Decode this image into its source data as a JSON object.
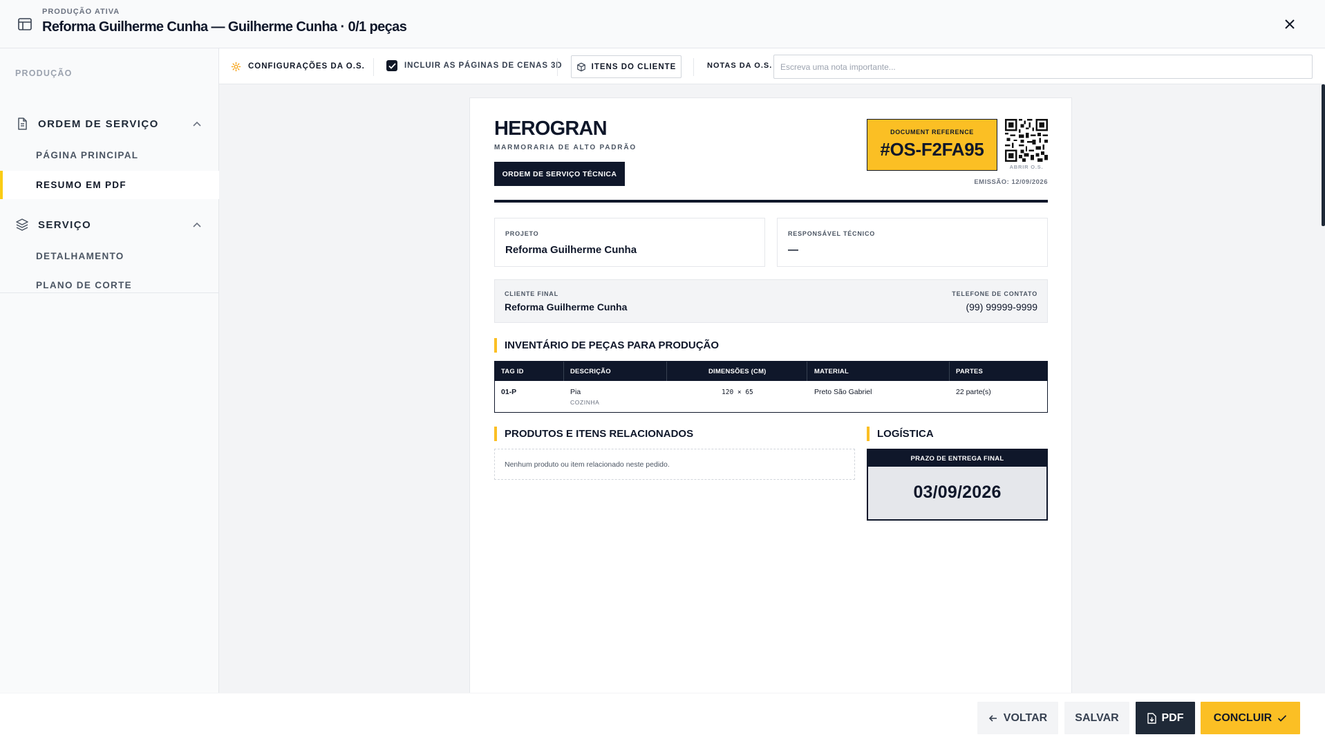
{
  "header": {
    "eyebrow": "PRODUÇÃO ATIVA",
    "title": "Reforma Guilherme Cunha — Guilherme Cunha · 0/1 peças"
  },
  "sidebar": {
    "section_label": "PRODUÇÃO",
    "groups": [
      {
        "label": "ORDEM DE SERVIÇO",
        "icon": "document-icon",
        "expanded": true,
        "items": [
          {
            "label": "PÁGINA PRINCIPAL",
            "active": false
          },
          {
            "label": "RESUMO EM PDF",
            "active": true
          }
        ]
      },
      {
        "label": "SERVIÇO",
        "icon": "layers-icon",
        "expanded": true,
        "items": [
          {
            "label": "DETALHAMENTO",
            "active": false
          },
          {
            "label": "PLANO DE CORTE",
            "active": false
          }
        ]
      }
    ]
  },
  "toolbar": {
    "config_label": "CONFIGURAÇÕES DA O.S.",
    "include_3d_label": "INCLUIR AS PÁGINAS DE CENAS 3D",
    "include_3d_checked": true,
    "client_items_label": "ITENS DO CLIENTE",
    "notes_label": "NOTAS DA O.S.",
    "notes_placeholder": "Escreva uma nota importante...",
    "notes_value": ""
  },
  "document": {
    "brand": "HEROGRAN",
    "brand_subtitle": "MARMORARIA DE ALTO PADRÃO",
    "doc_type": "ORDEM DE SERVIÇO TÉCNICA",
    "reference_label": "DOCUMENT REFERENCE",
    "reference_value": "#OS-F2FA95",
    "qr_label": "ABRIR O.S.",
    "emission": "EMISSÃO: 12/09/2026",
    "project_label": "PROJETO",
    "project_value": "Reforma Guilherme Cunha",
    "tech_label": "RESPONSÁVEL TÉCNICO",
    "tech_value": "—",
    "client_label": "CLIENTE FINAL",
    "client_value": "Reforma Guilherme Cunha",
    "phone_label": "TELEFONE DE CONTATO",
    "phone_value": "(99) 99999-9999",
    "inventory_title": "INVENTÁRIO DE PEÇAS PARA PRODUÇÃO",
    "table": {
      "headers": [
        "TAG ID",
        "DESCRIÇÃO",
        "DIMENSÕES (CM)",
        "MATERIAL",
        "PARTES"
      ],
      "rows": [
        {
          "tag": "01-P",
          "description": "Pia",
          "room": "COZINHA",
          "dimensions": "120 × 65",
          "material": "Preto São Gabriel",
          "parts": "22 parte(s)"
        }
      ]
    },
    "products_title": "PRODUTOS E ITENS RELACIONADOS",
    "products_empty": "Nenhum produto ou item relacionado neste pedido.",
    "logistics_title": "LOGÍSTICA",
    "delivery_label": "PRAZO DE ENTREGA FINAL",
    "delivery_date": "03/09/2026"
  },
  "footer": {
    "back_label": "VOLTAR",
    "save_label": "SALVAR",
    "pdf_label": "PDF",
    "done_label": "CONCLUIR"
  },
  "colors": {
    "accent": "#fbbf24",
    "dark": "#0f172a",
    "sidebar_bg": "#f9fafb",
    "workspace_bg": "#f3f4f6"
  }
}
